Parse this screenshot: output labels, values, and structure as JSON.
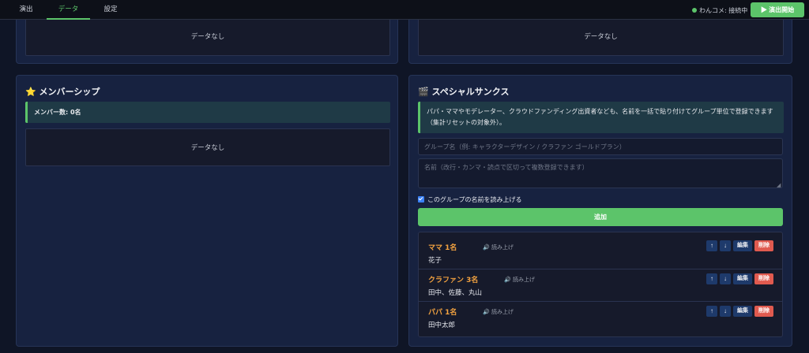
{
  "nav": {
    "tabs": [
      {
        "label": "演出"
      },
      {
        "label": "データ"
      },
      {
        "label": "設定"
      }
    ],
    "status": "わんコメ: 接続中",
    "start_button": "▶ 演出開始"
  },
  "top_panels": {
    "left_empty": "データなし",
    "right_empty": "データなし"
  },
  "membership": {
    "icon": "⭐",
    "title": "メンバーシップ",
    "count_text": "メンバー数: 0名",
    "empty": "データなし"
  },
  "special_thanks": {
    "icon": "🎬",
    "title": "スペシャルサンクス",
    "description": "パパ・ママやモデレーター、クラウドファンディング出資者なども、名前を一括で貼り付けてグループ単位で登録できます（集計リセットの対象外）。",
    "group_placeholder": "グループ名（例: キャラクターデザイン / クラファン ゴールドプラン）",
    "names_placeholder": "名前（改行・カンマ・読点で区切って複数登録できます）",
    "read_checkbox_label": "このグループの名前を読み上げる",
    "add_button": "追加",
    "groups": [
      {
        "name": "ママ 1名",
        "read_label": "🔊 読み上げ",
        "members": "花子"
      },
      {
        "name": "クラファン 3名",
        "read_label": "🔊 読み上げ",
        "members": "田中、佐藤、丸山"
      },
      {
        "name": "パパ 1名",
        "read_label": "🔊 読み上げ",
        "members": "田中太郎"
      }
    ],
    "up_label": "↑",
    "down_label": "↓",
    "edit_label": "編集",
    "delete_label": "削除"
  },
  "colors": {
    "accent": "#5cc46a",
    "group_name": "#f4a340",
    "delete": "#e05a4f"
  }
}
